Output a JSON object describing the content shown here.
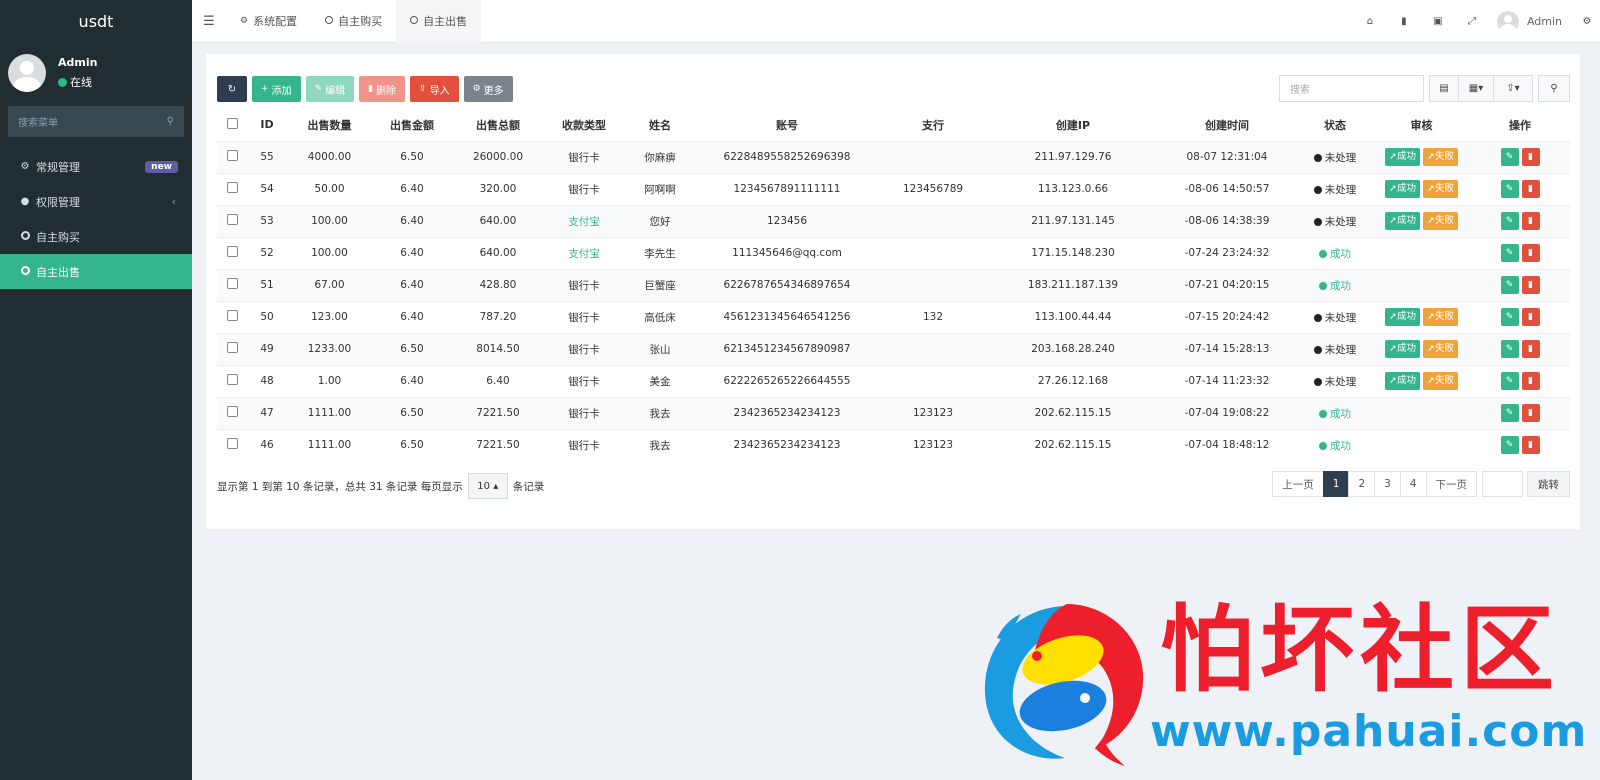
{
  "app": {
    "brand": "usdt"
  },
  "user": {
    "name": "Admin",
    "status": "在线"
  },
  "sidebar": {
    "search_placeholder": "搜索菜单",
    "items": [
      {
        "label": "常规管理",
        "badge": "new"
      },
      {
        "label": "权限管理",
        "arrow": "‹"
      },
      {
        "label": "自主购买"
      },
      {
        "label": "自主出售"
      }
    ]
  },
  "topbar": {
    "tabs": [
      {
        "label": "系统配置"
      },
      {
        "label": "自主购买"
      },
      {
        "label": "自主出售"
      }
    ],
    "user_name": "Admin"
  },
  "toolbar": {
    "add": "添加",
    "edit": "编辑",
    "delete": "删除",
    "import": "导入",
    "more": "更多",
    "search_placeholder": "搜索"
  },
  "table": {
    "headers": [
      "ID",
      "出售数量",
      "出售金额",
      "出售总额",
      "收款类型",
      "姓名",
      "账号",
      "支行",
      "创建IP",
      "创建时间",
      "状态",
      "审核",
      "操作"
    ],
    "review_labels": {
      "success": "成功",
      "fail": "失败"
    },
    "rows": [
      {
        "id": "55",
        "qty": "4000.00",
        "price": "6.50",
        "total": "26000.00",
        "type": "银行卡",
        "name": "你麻痹",
        "account": "6228489558252696398",
        "branch": "",
        "ip": "211.97.129.76",
        "time": "08-07 12:31:04",
        "status": "未处理"
      },
      {
        "id": "54",
        "qty": "50.00",
        "price": "6.40",
        "total": "320.00",
        "type": "银行卡",
        "name": "阿啊啊",
        "account": "1234567891111111",
        "branch": "123456789",
        "ip": "113.123.0.66",
        "time": "-08-06 14:50:57",
        "status": "未处理"
      },
      {
        "id": "53",
        "qty": "100.00",
        "price": "6.40",
        "total": "640.00",
        "type": "支付宝",
        "name": "您好",
        "account": "123456",
        "branch": "",
        "ip": "211.97.131.145",
        "time": "-08-06 14:38:39",
        "status": "未处理"
      },
      {
        "id": "52",
        "qty": "100.00",
        "price": "6.40",
        "total": "640.00",
        "type": "支付宝",
        "name": "李先生",
        "account": "111345646@qq.com",
        "branch": "",
        "ip": "171.15.148.230",
        "time": "-07-24 23:24:32",
        "status": "成功"
      },
      {
        "id": "51",
        "qty": "67.00",
        "price": "6.40",
        "total": "428.80",
        "type": "银行卡",
        "name": "巨蟹座",
        "account": "6226787654346897654",
        "branch": "",
        "ip": "183.211.187.139",
        "time": "-07-21 04:20:15",
        "status": "成功"
      },
      {
        "id": "50",
        "qty": "123.00",
        "price": "6.40",
        "total": "787.20",
        "type": "银行卡",
        "name": "高低床",
        "account": "4561231345646541256",
        "branch": "132",
        "ip": "113.100.44.44",
        "time": "-07-15 20:24:42",
        "status": "未处理"
      },
      {
        "id": "49",
        "qty": "1233.00",
        "price": "6.50",
        "total": "8014.50",
        "type": "银行卡",
        "name": "张山",
        "account": "6213451234567890987",
        "branch": "",
        "ip": "203.168.28.240",
        "time": "-07-14 15:28:13",
        "status": "未处理"
      },
      {
        "id": "48",
        "qty": "1.00",
        "price": "6.40",
        "total": "6.40",
        "type": "银行卡",
        "name": "美金",
        "account": "6222265265226644555",
        "branch": "",
        "ip": "27.26.12.168",
        "time": "-07-14 11:23:32",
        "status": "未处理"
      },
      {
        "id": "47",
        "qty": "1111.00",
        "price": "6.50",
        "total": "7221.50",
        "type": "银行卡",
        "name": "我去",
        "account": "2342365234234123",
        "branch": "123123",
        "ip": "202.62.115.15",
        "time": "-07-04 19:08:22",
        "status": "成功"
      },
      {
        "id": "46",
        "qty": "1111.00",
        "price": "6.50",
        "total": "7221.50",
        "type": "银行卡",
        "name": "我去",
        "account": "2342365234234123",
        "branch": "123123",
        "ip": "202.62.115.15",
        "time": "-07-04 18:48:12",
        "status": "成功"
      }
    ]
  },
  "footer": {
    "info_prefix": "显示第 1 到第 10 条记录，总共 31 条记录 每页显示",
    "page_size": "10",
    "info_suffix": "条记录"
  },
  "pagination": {
    "prev": "上一页",
    "pages": [
      "1",
      "2",
      "3",
      "4"
    ],
    "current": "1",
    "next": "下一页",
    "jump": "跳转"
  },
  "watermark": {
    "title": "怕坏社区",
    "url": "www.pahuai.com"
  },
  "colors": {
    "sidebar_bg": "#222d32",
    "accent_green": "#35b58b",
    "danger_red": "#e0503c",
    "warning_orange": "#f0a33a",
    "dark_navy": "#2f3e4e"
  }
}
